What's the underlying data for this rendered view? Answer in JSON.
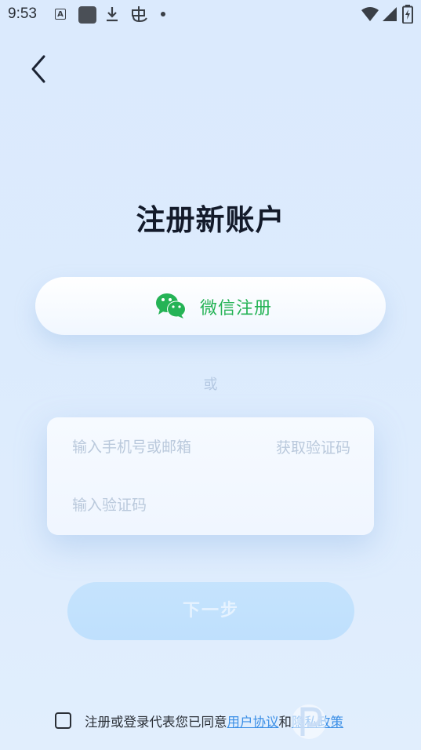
{
  "status_bar": {
    "time": "9:53",
    "icons": [
      "a-badge-icon",
      "square-app-icon",
      "download-icon",
      "bug-icon",
      "dot-icon",
      "wifi-icon",
      "signal-icon",
      "battery-charging-icon"
    ]
  },
  "header": {
    "back_icon": "chevron-left-icon"
  },
  "title": "注册新账户",
  "wechat": {
    "label": "微信注册",
    "icon": "wechat-icon",
    "color": "#25b356"
  },
  "divider_text": "或",
  "form": {
    "phone_placeholder": "输入手机号或邮箱",
    "phone_value": "",
    "get_code_label": "获取验证码",
    "code_placeholder": "输入验证码",
    "code_value": ""
  },
  "next_button_label": "下一步",
  "agreement": {
    "checked": false,
    "prefix": "注册或登录代表您已同意",
    "user_agreement": "用户协议",
    "conjunction": "和",
    "privacy_policy": "隐私政策"
  },
  "colors": {
    "accent": "#3b8fe6",
    "wechat_green": "#25b356",
    "next_button_bg": "#c5e3fd"
  }
}
